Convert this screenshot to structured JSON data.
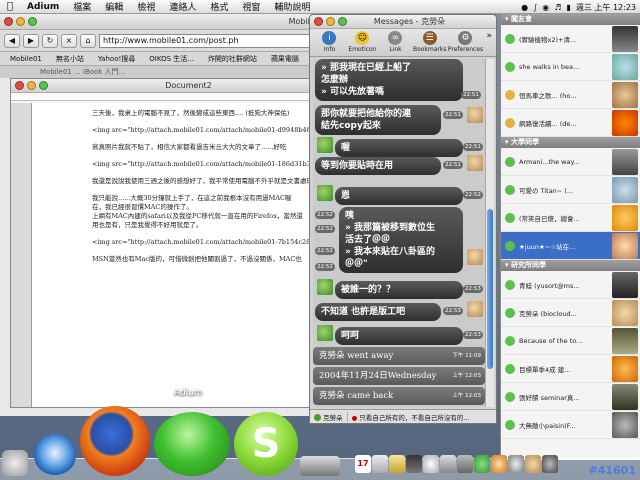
{
  "menubar": {
    "app": "Adium",
    "items": [
      "檔案",
      "編輯",
      "檢視",
      "連絡人",
      "格式",
      "視窗",
      "輔助說明"
    ],
    "clock": "週三 上午 12:23"
  },
  "browser": {
    "title": "Mobile01",
    "url": "http://www.mobile01.com/post.ph",
    "bookmarks": [
      "Mobile01",
      "無名小站",
      "Yahoo!搜尋",
      "OIKOS 生活...",
      "炸開的社群網站",
      "蘋果電腦"
    ],
    "tabs_text": "Mobile01 ... iBook 入門..."
  },
  "doc": {
    "title": "Document2",
    "paragraphs": [
      "三天後，我桌上的電腦不見了，然後變成這些東西.... (抵狗大神保佑)",
      "<img src=\"http://attach.mobile01.com/attach/mobile01-d9948b4600a2b1eb10544afe4b30c75e.jpg\">",
      "寫真照片我就不貼了，相信大家都看過吉米丘大大的文章了......好吃",
      "<img src=\"http://attach.mobile01.com/attach/mobile01-186d31b3af87de140occa55e9a148014.jpg\">",
      "我還是說說我使用三週之後的感想好了，我平常使用電腦不外乎就是文書處理，簡報製作，照片處理，一點點電玩這樣",
      "我只能說......大概30分鐘就上手了，在這之前我根本沒有用過MAC喔",
      "在，我已經很習慣MAC的操作了。",
      "上網有MAC內建的safari以及我從PC移代就一直在用的Firefox，當然還",
      "用也是有，只是我覺得不好用就是了。",
      "<img src=\"http://attach.mobile01.com/attach/mobile01-7b154c28e9618e695a111165d87c67dc.jpg\">",
      "MSN當然也有Mac版的，可惜微創把他閹割過了，不過沒關係，MAC也"
    ]
  },
  "messages": {
    "title": "Messages - 克勞朵",
    "toolbar": [
      "Info",
      "Emoticon",
      "Link",
      "Bookmarks",
      "Preferences"
    ],
    "chat": [
      {
        "side": "right",
        "text": "» 那我現在已經上船了\n怎麼辦\n» 可以先放著嗎",
        "time": "22:51"
      },
      {
        "side": "right",
        "text": "那你就要把他給你的連\n結先copy起來",
        "time": "22:51"
      },
      {
        "side": "left",
        "text": "喔",
        "time": "22:51"
      },
      {
        "side": "right",
        "text": "等到你要貼時在用",
        "time": "22:51"
      },
      {
        "side": "left",
        "text": "恩",
        "time": "22:52"
      },
      {
        "side": "left",
        "text": "咦\n» 我那篇被移到數位生\n活去了＠＠\n» 我本來貼在八卦區的\n＠＠\"",
        "times": [
          "22:52",
          "22:52",
          "22:52",
          "22:52"
        ]
      },
      {
        "side": "left",
        "text": "被誰一的？？",
        "time": "22:53"
      },
      {
        "side": "right",
        "text": "不知道 也許是版工吧",
        "time": "22:53"
      },
      {
        "side": "left",
        "text": "呵呵",
        "time": "22:53"
      }
    ],
    "status": [
      {
        "text": "克勞朵 went away",
        "time": "下午 11:09"
      },
      {
        "text": "2004年11月24日Wednesday",
        "time": "上午 12:03"
      },
      {
        "text": "克勞朵 came back",
        "time": "上午 12:03"
      }
    ],
    "bottom_tabs": [
      "克勞朵",
      "只看自己所有的，不看自己所沒有的..."
    ]
  },
  "buddy": {
    "groups": [
      {
        "name": "闖友會",
        "buddies": [
          "(實驗植物x2)+清...",
          "she walks in bea...",
          "恒馬車之歌... (ho...",
          "網路復活續... (de..."
        ]
      },
      {
        "name": "大學同學",
        "buddies": [
          "Armani...the way...",
          "可愛の Titan~ (...",
          "(常笑自已傻，總會...",
          "★juun★~☆站在..."
        ]
      },
      {
        "name": "研究所同學",
        "buddies": [
          "青蛙 (yusort@ms...",
          "克勞朵 (biocloud...",
          "Because of the to...",
          "目標單季4成 建...",
          "張好饋 seminar真...",
          "大無敵小paisin(F..."
        ]
      }
    ]
  },
  "dock": {
    "label": "Adium",
    "calendar_day": "17"
  },
  "watermark": "#41601",
  "colors": {
    "bubble": "#3a3a3a",
    "menubar": "#e8e8e8",
    "accent": "#3b6fc7"
  }
}
